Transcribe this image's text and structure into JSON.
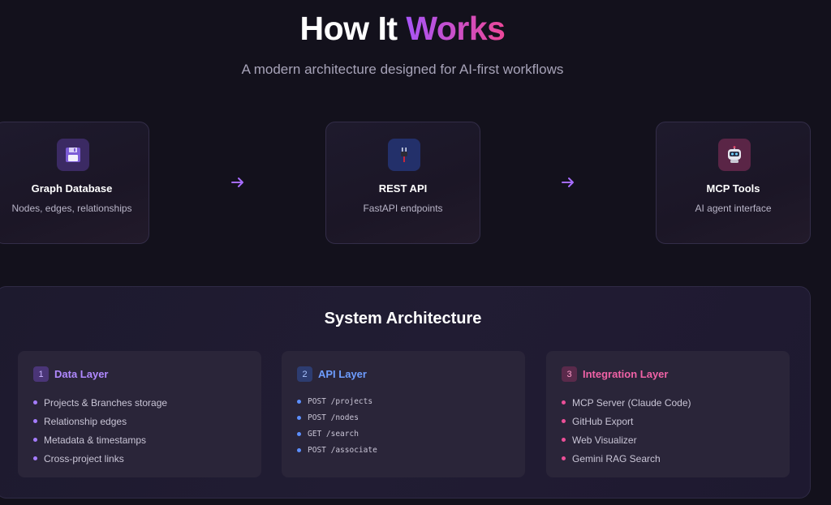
{
  "header": {
    "title_main": "How It",
    "title_accent": "Works",
    "subtitle": "A modern architecture designed for AI-first workflows"
  },
  "flow": {
    "cards": [
      {
        "icon": "floppy-disk-icon",
        "name": "Graph Database",
        "description": "Nodes, edges, relationships"
      },
      {
        "icon": "plug-icon",
        "name": "REST API",
        "description": "FastAPI endpoints"
      },
      {
        "icon": "robot-icon",
        "name": "MCP Tools",
        "description": "AI agent interface"
      }
    ],
    "arrow_icon": "arrow-right-icon"
  },
  "architecture": {
    "title": "System Architecture",
    "layers": [
      {
        "number": "1",
        "title": "Data Layer",
        "items": [
          "Projects & Branches storage",
          "Relationship edges",
          "Metadata & timestamps",
          "Cross-project links"
        ]
      },
      {
        "number": "2",
        "title": "API Layer",
        "items": [
          "POST /projects",
          "POST /nodes",
          "GET /search",
          "POST /associate"
        ]
      },
      {
        "number": "3",
        "title": "Integration Layer",
        "items": [
          "MCP Server (Claude Code)",
          "GitHub Export",
          "Web Visualizer",
          "Gemini RAG Search"
        ]
      }
    ]
  },
  "colors": {
    "background": "#13111c",
    "accent_purple": "#a855f7",
    "accent_pink": "#ec4899",
    "data_layer": "#b089ff",
    "api_layer": "#6e9dff",
    "integration_layer": "#f062a6"
  }
}
